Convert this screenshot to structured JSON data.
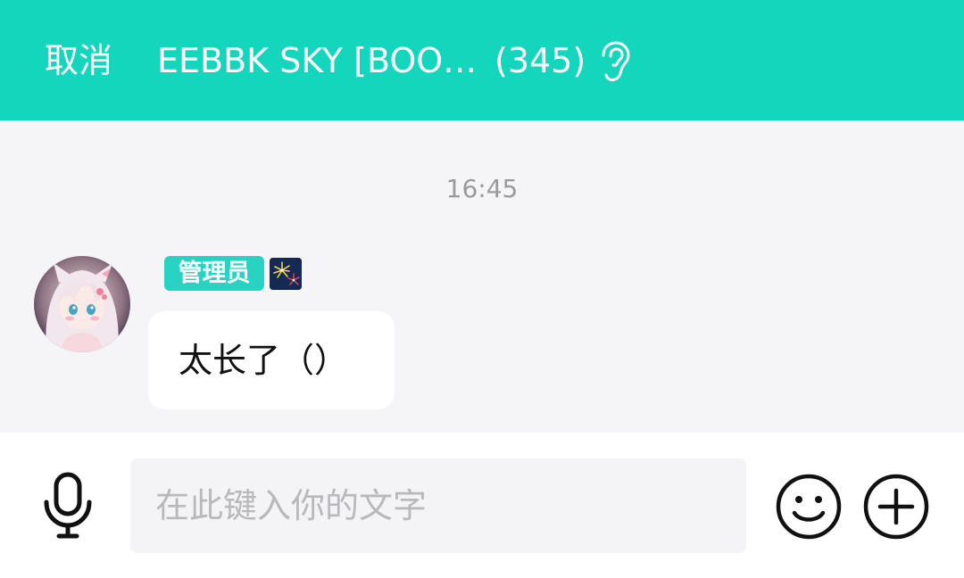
{
  "header": {
    "cancel_label": "取消",
    "group_title": "EEBBK SKY [BOO…",
    "member_count": "(345)",
    "ear_icon": "ear-icon",
    "background_color": "#13d6bd"
  },
  "chat": {
    "timestamp": "16:45",
    "messages": [
      {
        "role_badge": "管理员",
        "badge_color": "#28d3c4",
        "title_icon": "fireworks-icon",
        "avatar": "anime-girl-avatar",
        "text": "太长了（）"
      }
    ]
  },
  "input": {
    "placeholder": "在此键入你的文字",
    "value": "",
    "mic_icon": "microphone-icon",
    "emoji_icon": "smiley-icon",
    "plus_icon": "plus-icon"
  }
}
